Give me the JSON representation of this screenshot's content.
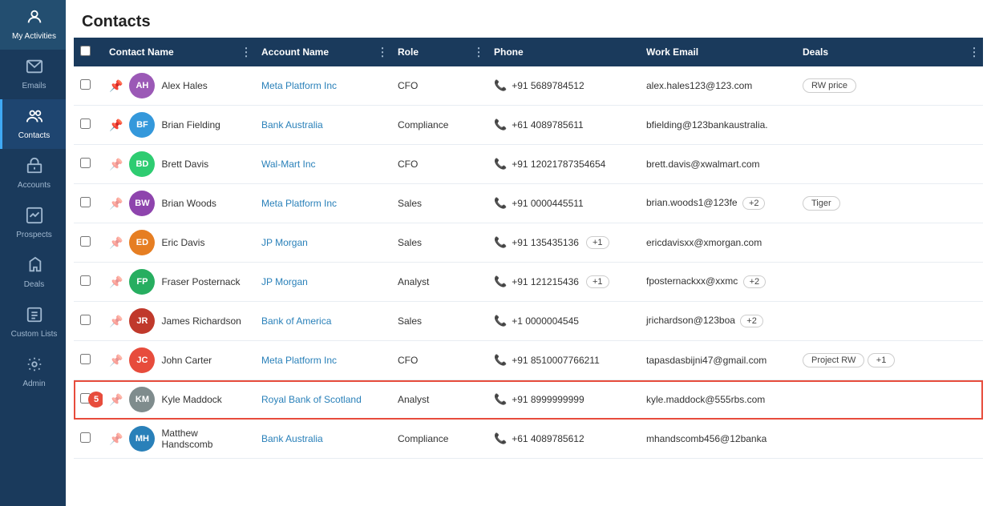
{
  "sidebar": {
    "items": [
      {
        "id": "my-activities",
        "label": "My Activities",
        "icon": "👤",
        "active": false
      },
      {
        "id": "emails",
        "label": "Emails",
        "icon": "✉️",
        "active": false
      },
      {
        "id": "contacts",
        "label": "Contacts",
        "icon": "👥",
        "active": true
      },
      {
        "id": "accounts",
        "label": "Accounts",
        "icon": "🏛️",
        "active": false
      },
      {
        "id": "prospects",
        "label": "Prospects",
        "icon": "📊",
        "active": false
      },
      {
        "id": "deals",
        "label": "Deals",
        "icon": "🤝",
        "active": false
      },
      {
        "id": "custom-lists",
        "label": "Custom Lists",
        "icon": "📋",
        "active": false
      },
      {
        "id": "admin",
        "label": "Admin",
        "icon": "⚙️",
        "active": false
      }
    ]
  },
  "page": {
    "title": "Contacts"
  },
  "table": {
    "columns": [
      {
        "id": "check",
        "label": ""
      },
      {
        "id": "contact-name",
        "label": "Contact Name"
      },
      {
        "id": "account-name",
        "label": "Account Name"
      },
      {
        "id": "role",
        "label": "Role"
      },
      {
        "id": "phone",
        "label": "Phone"
      },
      {
        "id": "work-email",
        "label": "Work Email"
      },
      {
        "id": "deals",
        "label": "Deals"
      }
    ],
    "rows": [
      {
        "id": 1,
        "pinned": true,
        "avatar_initials": "AH",
        "avatar_color": "#9b59b6",
        "contact_name": "Alex Hales",
        "account_name": "Meta Platform Inc",
        "role": "CFO",
        "phone": "+91 5689784512",
        "email": "alex.hales123@123.com",
        "deals": [
          "RW price"
        ],
        "extra_phones": 0,
        "extra_emails": 0,
        "extra_deals": 0,
        "highlight": false,
        "notification": 0
      },
      {
        "id": 2,
        "pinned": true,
        "avatar_initials": "BF",
        "avatar_color": "#3498db",
        "contact_name": "Brian Fielding",
        "account_name": "Bank Australia",
        "role": "Compliance",
        "phone": "+61 4089785611",
        "email": "bfielding@123bankaustralia.",
        "deals": [],
        "extra_phones": 0,
        "extra_emails": 0,
        "extra_deals": 0,
        "highlight": false,
        "notification": 0
      },
      {
        "id": 3,
        "pinned": false,
        "avatar_initials": "BD",
        "avatar_color": "#2ecc71",
        "contact_name": "Brett Davis",
        "account_name": "Wal-Mart Inc",
        "role": "CFO",
        "phone": "+91 12021787354654",
        "email": "brett.davis@xwalmart.com",
        "deals": [],
        "extra_phones": 0,
        "extra_emails": 0,
        "extra_deals": 0,
        "highlight": false,
        "notification": 0
      },
      {
        "id": 4,
        "pinned": false,
        "avatar_initials": "BW",
        "avatar_color": "#8e44ad",
        "contact_name": "Brian Woods",
        "account_name": "Meta Platform Inc",
        "role": "Sales",
        "phone": "+91 0000445511",
        "email": "brian.woods1@123fe",
        "deals": [
          "Tiger"
        ],
        "extra_phones": 0,
        "extra_emails": 2,
        "extra_deals": 0,
        "highlight": false,
        "notification": 0
      },
      {
        "id": 5,
        "pinned": false,
        "avatar_initials": "ED",
        "avatar_color": "#e67e22",
        "contact_name": "Eric Davis",
        "account_name": "JP Morgan",
        "role": "Sales",
        "phone": "+91 135435136",
        "email": "ericdavisxx@xmorgan.com",
        "deals": [],
        "extra_phones": 1,
        "extra_emails": 0,
        "extra_deals": 0,
        "highlight": false,
        "notification": 0
      },
      {
        "id": 6,
        "pinned": false,
        "avatar_initials": "FP",
        "avatar_color": "#27ae60",
        "contact_name": "Fraser Posternack",
        "account_name": "JP Morgan",
        "role": "Analyst",
        "phone": "+91 121215436",
        "email": "fposternackxx@xxmc",
        "deals": [],
        "extra_phones": 1,
        "extra_emails": 2,
        "extra_deals": 0,
        "highlight": false,
        "notification": 0
      },
      {
        "id": 7,
        "pinned": false,
        "avatar_initials": "JR",
        "avatar_color": "#c0392b",
        "contact_name": "James Richardson",
        "account_name": "Bank of America",
        "role": "Sales",
        "phone": "+1 0000004545",
        "email": "jrichardson@123boa",
        "deals": [],
        "extra_phones": 0,
        "extra_emails": 2,
        "extra_deals": 0,
        "highlight": false,
        "notification": 0
      },
      {
        "id": 8,
        "pinned": false,
        "avatar_initials": "JC",
        "avatar_color": "#e74c3c",
        "contact_name": "John Carter",
        "account_name": "Meta Platform Inc",
        "role": "CFO",
        "phone": "+91 8510007766211",
        "email": "tapasdasbijni47@gmail.com",
        "deals": [
          "Project RW"
        ],
        "extra_phones": 0,
        "extra_emails": 0,
        "extra_deals": 1,
        "highlight": false,
        "notification": 0
      },
      {
        "id": 9,
        "pinned": false,
        "avatar_initials": "KM",
        "avatar_color": "#7f8c8d",
        "contact_name": "Kyle Maddock",
        "account_name": "Royal Bank of Scotland",
        "role": "Analyst",
        "phone": "+91 8999999999",
        "email": "kyle.maddock@555rbs.com",
        "deals": [],
        "extra_phones": 0,
        "extra_emails": 0,
        "extra_deals": 0,
        "highlight": true,
        "notification": 5
      },
      {
        "id": 10,
        "pinned": false,
        "avatar_initials": "MH",
        "avatar_color": "#2980b9",
        "contact_name": "Matthew Handscomb",
        "account_name": "Bank Australia",
        "role": "Compliance",
        "phone": "+61 4089785612",
        "email": "mhandscomb456@12banka",
        "deals": [],
        "extra_phones": 0,
        "extra_emails": 0,
        "extra_deals": 0,
        "highlight": false,
        "notification": 0
      }
    ]
  }
}
